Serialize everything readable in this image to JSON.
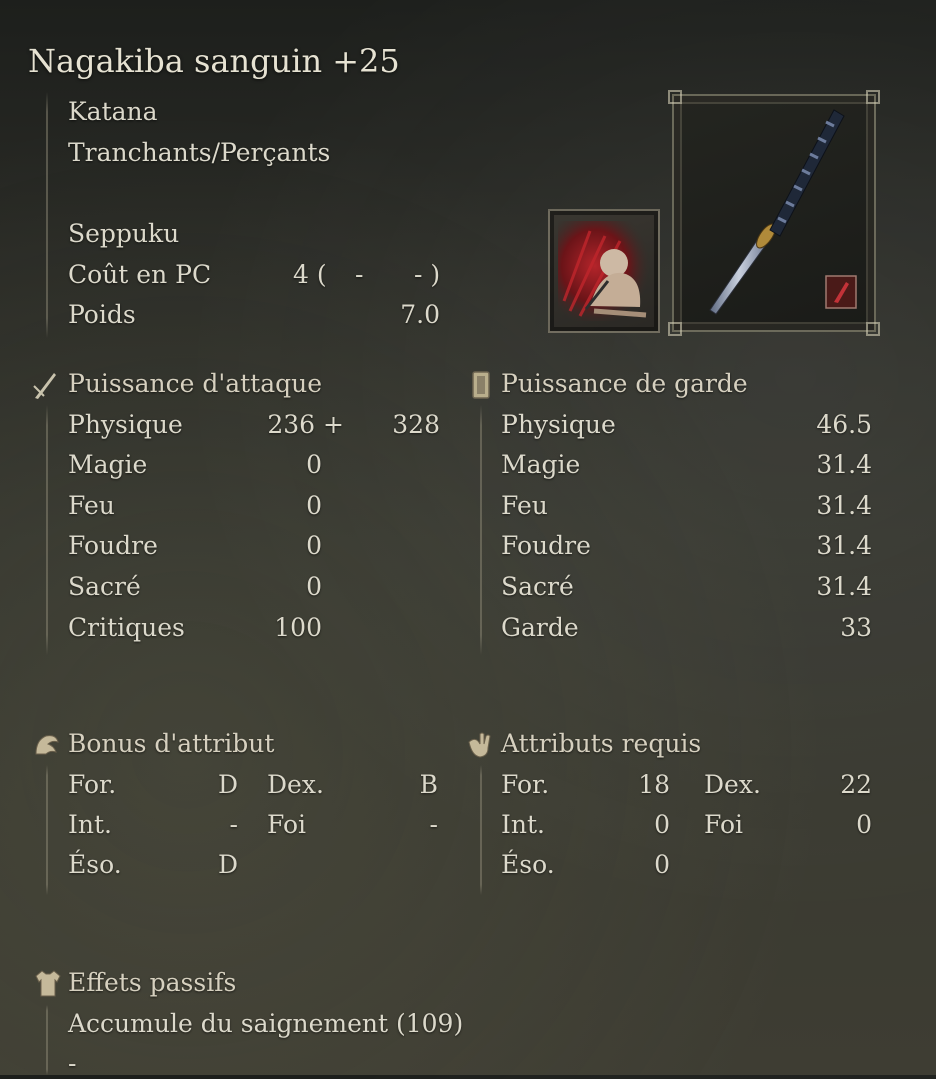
{
  "weapon": {
    "name": "Nagakiba sanguin +25",
    "type": "Katana",
    "damage_type": "Tranchants/Perçants",
    "skill": "Seppuku",
    "fp_cost_label": "Coût en PC",
    "fp_cost": "4 (",
    "fp_cost_mid": "-",
    "fp_cost_end": "- )",
    "weight_label": "Poids",
    "weight": "7.0"
  },
  "attack": {
    "title": "Puissance d'attaque",
    "rows": [
      {
        "label": "Physique",
        "value": "236 +",
        "bonus": "328"
      },
      {
        "label": "Magie",
        "value": "0",
        "bonus": ""
      },
      {
        "label": "Feu",
        "value": "0",
        "bonus": ""
      },
      {
        "label": "Foudre",
        "value": "0",
        "bonus": ""
      },
      {
        "label": "Sacré",
        "value": "0",
        "bonus": ""
      },
      {
        "label": "Critiques",
        "value": "100",
        "bonus": ""
      }
    ]
  },
  "guard": {
    "title": "Puissance de garde",
    "rows": [
      {
        "label": "Physique",
        "value": "46.5"
      },
      {
        "label": "Magie",
        "value": "31.4"
      },
      {
        "label": "Feu",
        "value": "31.4"
      },
      {
        "label": "Foudre",
        "value": "31.4"
      },
      {
        "label": "Sacré",
        "value": "31.4"
      },
      {
        "label": "Garde",
        "value": "33"
      }
    ]
  },
  "scaling": {
    "title": "Bonus d'attribut",
    "str_label": "For.",
    "str": "D",
    "dex_label": "Dex.",
    "dex": "B",
    "int_label": "Int.",
    "int": "-",
    "fai_label": "Foi",
    "fai": "-",
    "arc_label": "Éso.",
    "arc": "D"
  },
  "requirements": {
    "title": "Attributs requis",
    "str_label": "For.",
    "str": "18",
    "dex_label": "Dex.",
    "dex": "22",
    "int_label": "Int.",
    "int": "0",
    "fai_label": "Foi",
    "fai": "0",
    "arc_label": "Éso.",
    "arc": "0"
  },
  "passive": {
    "title": "Effets passifs",
    "effect1": "Accumule du saignement (109)",
    "effect2": "-"
  },
  "icons": {
    "attack": "sword-icon",
    "guard": "shield-icon",
    "scaling": "arm-icon",
    "requirements": "hand-icon",
    "passive": "armor-icon",
    "skill": "seppuku-skill-icon",
    "weapon": "katana-icon",
    "affinity": "blood-affinity-icon"
  },
  "colors": {
    "text": "#dcd9cb",
    "frame": "#aaa58c",
    "blood": "#8f1c1c"
  }
}
